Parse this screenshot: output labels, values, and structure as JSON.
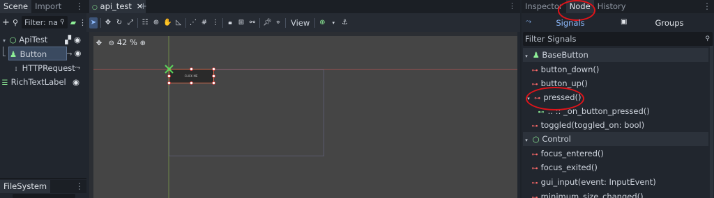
{
  "scene_dock": {
    "tabs": [
      "Scene",
      "Import"
    ],
    "filter_placeholder": "Filter: na",
    "tree": [
      {
        "label": "ApiTest",
        "icon": "control-node-icon"
      },
      {
        "label": "Button",
        "icon": "button-node-icon",
        "selected": true
      },
      {
        "label": "HTTPRequest",
        "icon": "http-request-node-icon"
      },
      {
        "label": "RichTextLabel",
        "icon": "rich-text-label-icon"
      }
    ]
  },
  "filesystem_dock": {
    "tab": "FileSystem"
  },
  "editor": {
    "scene_tab": "api_test",
    "view_menu": "View",
    "zoom": "42 %",
    "canvas_button_text": "CLICK ME"
  },
  "inspector_dock": {
    "tabs": [
      "Inspector",
      "Node",
      "History"
    ],
    "active_tab": "Node",
    "subtabs": [
      "Signals",
      "Groups"
    ],
    "filter_placeholder": "Filter Signals",
    "sections": [
      {
        "title": "BaseButton",
        "signals": [
          "button_down()",
          "button_up()",
          "pressed()",
          ".. :: _on_button_pressed()",
          "toggled(toggled_on: bool)"
        ]
      },
      {
        "title": "Control",
        "signals": [
          "focus_entered()",
          "focus_exited()",
          "gui_input(event: InputEvent)",
          "minimum_size_changed()"
        ]
      }
    ]
  },
  "colors": {
    "accent": "#8fbcff",
    "annotation": "#e0141a",
    "signal_icon": "#ff6a6a",
    "node_green": "#8eef97"
  }
}
